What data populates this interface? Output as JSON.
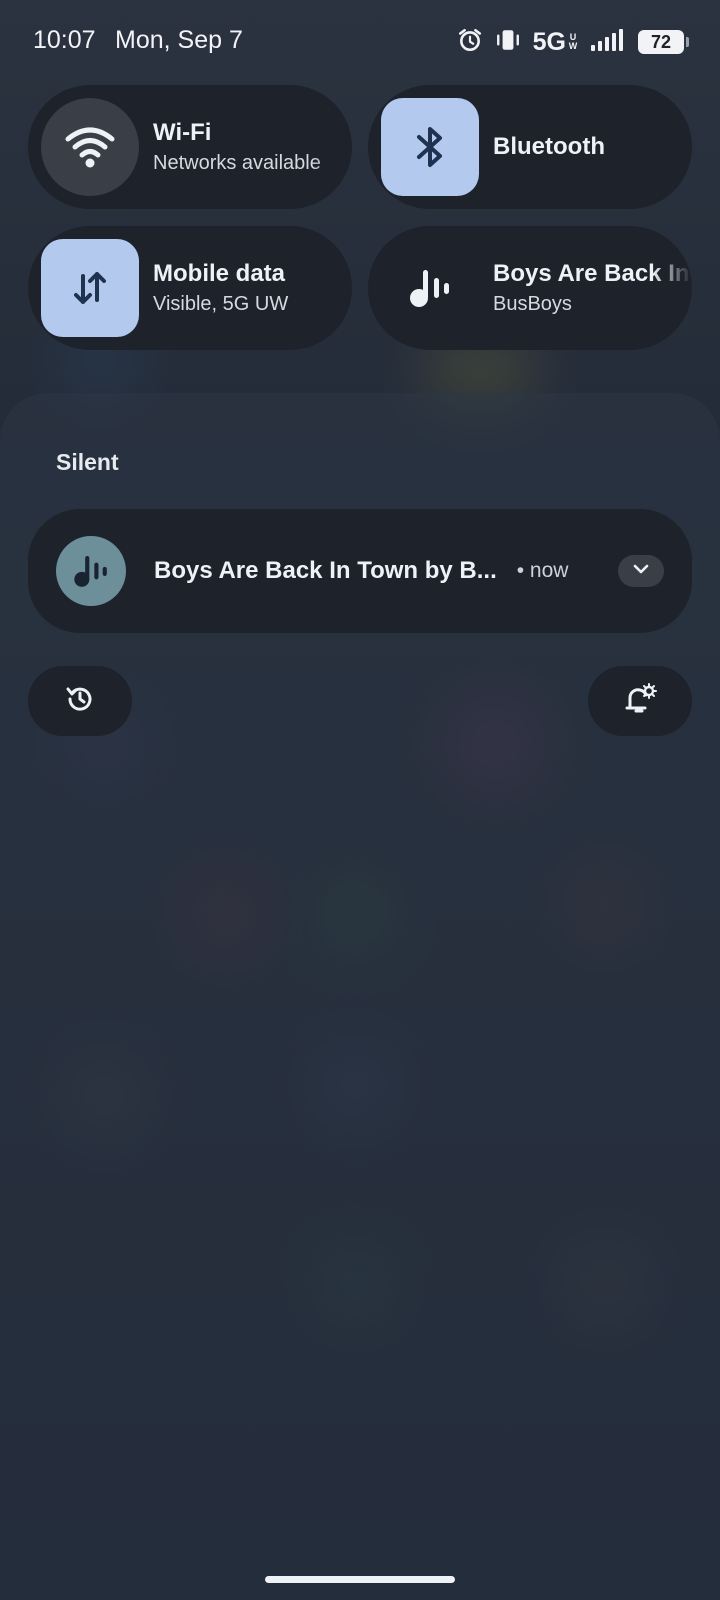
{
  "status_bar": {
    "time": "10:07",
    "date": "Mon, Sep 7",
    "network": "5G",
    "network_suffix_top": "U",
    "network_suffix_bottom": "W",
    "battery": "72",
    "icons": [
      "alarm-icon",
      "vibrate-icon",
      "signal-icon",
      "battery-icon"
    ]
  },
  "quick_settings": [
    {
      "title": "Wi-Fi",
      "subtitle": "Networks available",
      "icon": "wifi-icon",
      "active": false
    },
    {
      "title": "Bluetooth",
      "subtitle": "",
      "icon": "bluetooth-icon",
      "active": true
    },
    {
      "title": "Mobile data",
      "subtitle": "Visible, 5G UW",
      "icon": "mobile-data-icon",
      "active": true
    },
    {
      "title": "Boys Are Back In Town",
      "subtitle": "BusBoys",
      "icon": "music-icon",
      "active": false
    }
  ],
  "notifications": {
    "section_label": "Silent",
    "items": [
      {
        "title": "Boys Are Back In Town by B...",
        "time": "• now",
        "icon": "music-icon"
      }
    ]
  },
  "actions": {
    "history_icon": "history-icon",
    "settings_icon": "notification-settings-icon"
  },
  "colors": {
    "tile_bg": "#1d222b",
    "tile_active": "#b3c9ee",
    "tile_inactive_icon_bg": "#3a3f47",
    "notif_app_icon": "#6c8f99"
  }
}
